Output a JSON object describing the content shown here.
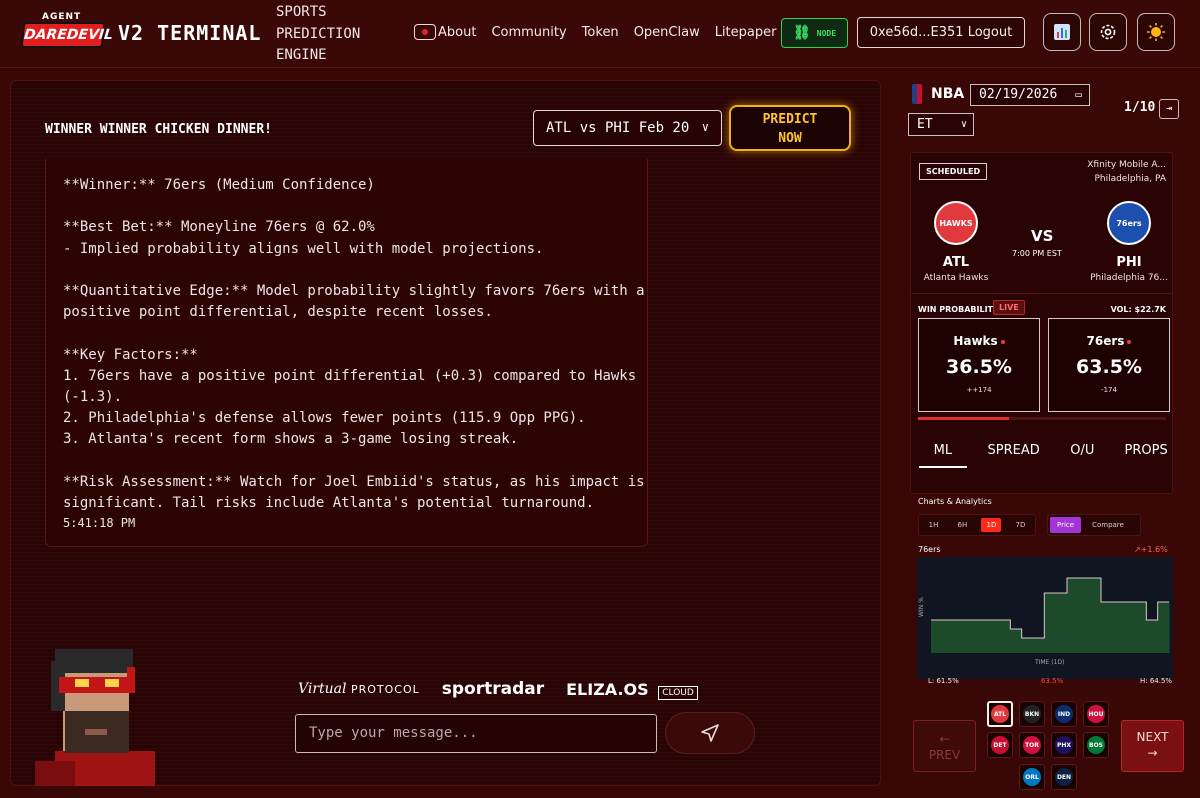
{
  "header": {
    "logo_top": "AGENT",
    "logo_main": "DAREDEVIL",
    "title": "V2 TERMINAL",
    "subtitle": "SPORTS PREDICTION ENGINE",
    "nav": [
      "About",
      "Community",
      "Token",
      "OpenClaw",
      "Litepaper"
    ],
    "node_label": "NODE",
    "wallet": "0xe56d...E351 Logout",
    "icons": [
      "stats-icon",
      "settings-icon",
      "theme-sun-icon"
    ]
  },
  "chat": {
    "title": "WINNER WINNER CHICKEN DINNER!",
    "match_select": "ATL vs PHI Feb 20",
    "predict_label_1": "PREDICT",
    "predict_label_2": "NOW",
    "message_lines": [
      "**Winner:** 76ers (Medium Confidence)",
      "",
      "**Best Bet:** Moneyline 76ers @ 62.0%",
      "- Implied probability aligns well with model projections.",
      "",
      "**Quantitative Edge:** Model probability slightly favors 76ers with a",
      "positive point differential, despite recent losses.",
      "",
      "**Key Factors:**",
      "1. 76ers have a positive point differential (+0.3) compared to Hawks",
      "(-1.3).",
      "2. Philadelphia's defense allows fewer points (115.9 Opp PPG).",
      "3. Atlanta's recent form shows a 3-game losing streak.",
      "",
      "**Risk Assessment:** Watch for Joel Embiid's status, as his impact is",
      "significant. Tail risks include Atlanta's potential turnaround."
    ],
    "message_time": "5:41:18 PM",
    "input_placeholder": "Type your message...",
    "partners": {
      "virtual": "Virtual",
      "virtual_suffix": "PROTOCOL",
      "sportradar": "sportradar",
      "eliza": "ELIZA.OS",
      "eliza_suffix": "CLOUD"
    }
  },
  "sidebar": {
    "league": "NBA",
    "date": "02/19/2026",
    "timezone": "ET",
    "page": "1/10",
    "game": {
      "status": "SCHEDULED",
      "venue_line1": "Xfinity Mobile A...",
      "venue_line2": "Philadelphia, PA",
      "home_abbr": "ATL",
      "home_name": "Atlanta Hawks",
      "away_abbr": "PHI",
      "away_name": "Philadelphia 76...",
      "vs": "VS",
      "time": "7:00 PM EST",
      "home_logo_text": "HAWKS",
      "away_logo_text": "76ers"
    },
    "win_prob": {
      "label": "WIN PROBABILITY",
      "live": "LIVE",
      "volume": "VOL: $22.7K",
      "team1": "Hawks",
      "team1_pct": "36.5%",
      "team1_odds": "++174",
      "team2": "76ers",
      "team2_pct": "63.5%",
      "team2_odds": "-174",
      "bar_fraction": 0.365
    },
    "tabs": [
      "ML",
      "SPREAD",
      "O/U",
      "PROPS"
    ],
    "charts": {
      "label": "Charts & Analytics",
      "ranges": [
        "1H",
        "6H",
        "1D",
        "7D"
      ],
      "active_range": "1D",
      "views": [
        "Price",
        "Compare"
      ],
      "active_view": "Price",
      "team": "76ers",
      "change": "+1.6%",
      "low": "L: 61.5%",
      "current": "63.5%",
      "high": "H: 64.5%",
      "xlabel": "TIME (1D)",
      "ylabel": "WIN %"
    },
    "prev_label": "←",
    "prev_text": "PREV",
    "next_label": "NEXT",
    "next_arrow": "→",
    "team_chips": [
      "ATL",
      "BKN",
      "IND",
      "HOU",
      "DET",
      "TOR",
      "PHX",
      "BOS",
      "ORL",
      "DEN"
    ]
  },
  "chart_data": {
    "type": "area",
    "title": "76ers",
    "xlabel": "TIME (1D)",
    "ylabel": "WIN %",
    "ylim": [
      61.5,
      64.5
    ],
    "x": [
      0,
      1,
      2,
      3,
      4,
      5,
      6,
      7,
      8,
      9,
      10,
      11,
      12,
      13,
      14,
      15,
      16,
      17,
      18,
      19,
      20
    ],
    "series": [
      {
        "name": "76ers",
        "values": [
          62.6,
          62.6,
          62.6,
          62.6,
          62.6,
          62.6,
          62.6,
          62.3,
          62.0,
          62.0,
          63.5,
          63.5,
          64.0,
          64.0,
          64.0,
          63.2,
          63.2,
          63.2,
          63.2,
          62.6,
          63.2
        ]
      }
    ],
    "colors": {
      "line": "#d8c7c7",
      "fill": "#1e4a2c",
      "bg": "#0f1621"
    }
  }
}
